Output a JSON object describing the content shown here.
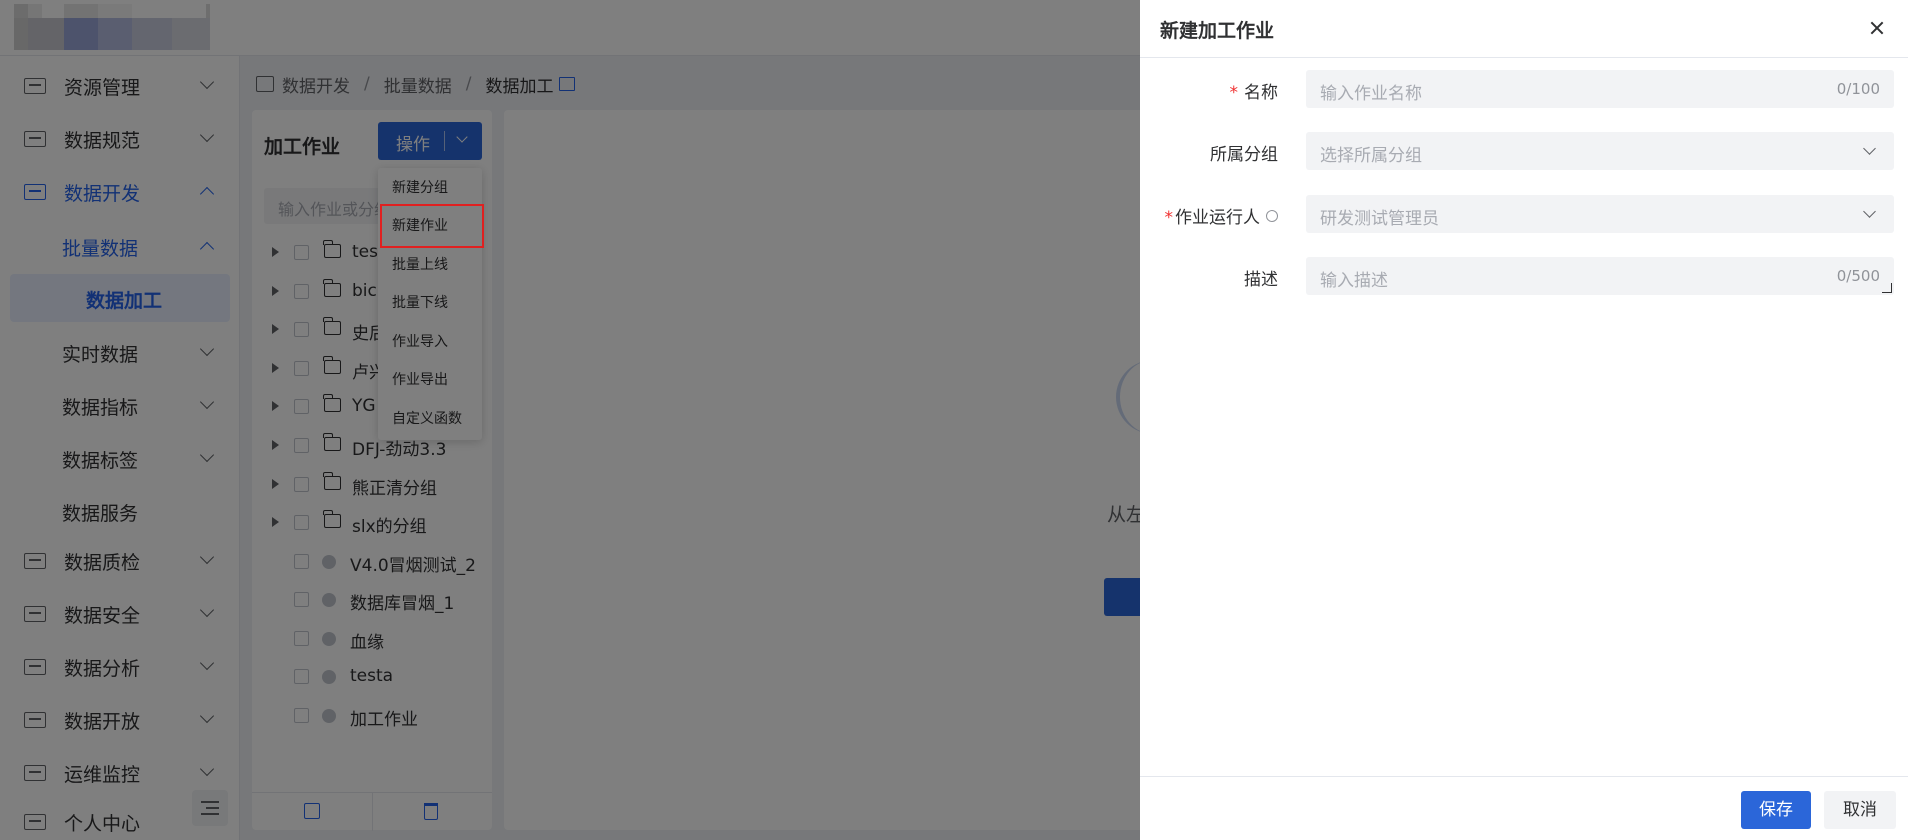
{
  "colors": {
    "primary": "#2b66d9",
    "active_text": "#2563eb",
    "required": "#f03030",
    "highlight_box": "#e02020",
    "overlay": "rgba(0,0,0,0.5)"
  },
  "sidebar": {
    "items": [
      {
        "label": "资源管理",
        "icon": "server-icon"
      },
      {
        "label": "数据规范",
        "icon": "monitor-icon"
      },
      {
        "label": "数据开发",
        "icon": "code-icon"
      },
      {
        "label": "数据质检",
        "icon": "checklist-icon"
      },
      {
        "label": "数据安全",
        "icon": "shield-icon"
      },
      {
        "label": "数据分析",
        "icon": "chart-icon"
      },
      {
        "label": "数据开放",
        "icon": "share-icon"
      },
      {
        "label": "运维监控",
        "icon": "monitor-line-icon"
      },
      {
        "label": "个人中心",
        "icon": "user-icon"
      }
    ],
    "sub_items": [
      {
        "label": "批量数据"
      },
      {
        "label": "数据加工"
      },
      {
        "label": "实时数据"
      },
      {
        "label": "数据指标"
      },
      {
        "label": "数据标签"
      },
      {
        "label": "数据服务"
      }
    ]
  },
  "breadcrumb": {
    "items": [
      "数据开发",
      "批量数据",
      "数据加工"
    ],
    "separator": "/"
  },
  "job_panel": {
    "title": "加工作业",
    "operate_button": "操作",
    "search_placeholder": "输入作业或分组",
    "tree": [
      {
        "label": "tes",
        "type": "folder"
      },
      {
        "label": "bic",
        "type": "folder"
      },
      {
        "label": "史后",
        "type": "folder"
      },
      {
        "label": "卢兴",
        "type": "folder"
      },
      {
        "label": "YG",
        "type": "folder"
      },
      {
        "label": "DFJ-劲动3.3",
        "type": "folder"
      },
      {
        "label": "熊正清分组",
        "type": "folder"
      },
      {
        "label": "slx的分组",
        "type": "folder"
      },
      {
        "label": "V4.0冒烟测试_2",
        "type": "job"
      },
      {
        "label": "数据库冒烟_1",
        "type": "job"
      },
      {
        "label": "血缘",
        "type": "job"
      },
      {
        "label": "testa",
        "type": "job"
      },
      {
        "label": "加工作业",
        "type": "job"
      }
    ]
  },
  "operate_menu": {
    "items": [
      "新建分组",
      "新建作业",
      "批量上线",
      "批量下线",
      "作业导入",
      "作业导出",
      "自定义函数"
    ],
    "highlighted": "新建作业"
  },
  "main": {
    "empty_text": "从左"
  },
  "drawer": {
    "title": "新建加工作业",
    "fields": {
      "name": {
        "label": "名称",
        "placeholder": "输入作业名称",
        "count": "0/100",
        "required": true
      },
      "group": {
        "label": "所属分组",
        "placeholder": "选择所属分组"
      },
      "runner": {
        "label": "作业运行人",
        "value": "研发测试管理员",
        "required": true
      },
      "desc": {
        "label": "描述",
        "placeholder": "输入描述",
        "count": "0/500"
      }
    },
    "save_label": "保存",
    "cancel_label": "取消"
  }
}
